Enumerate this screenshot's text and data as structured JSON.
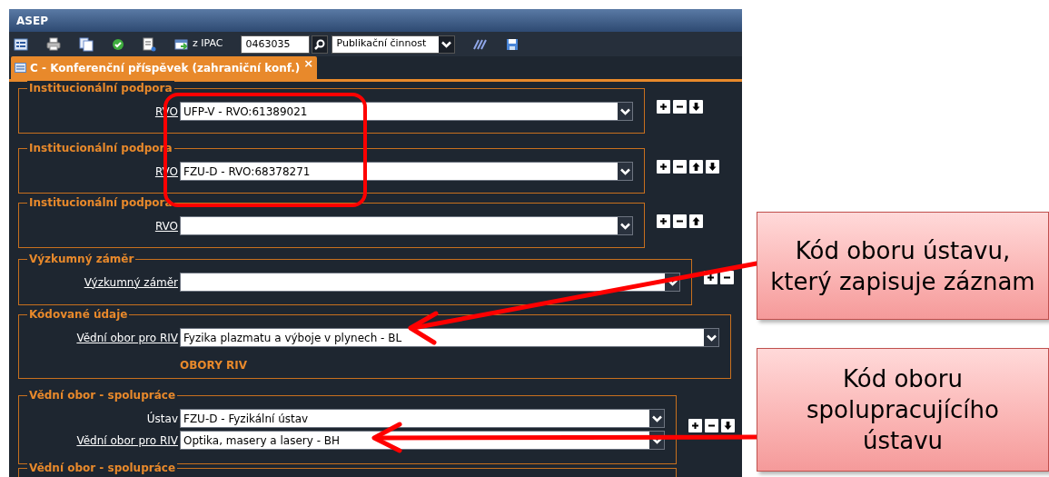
{
  "window": {
    "title": "ASEP"
  },
  "toolbar": {
    "import_button": {
      "label": "z IPAC"
    },
    "record_field": {
      "value": "0463035"
    },
    "type_select": {
      "value": "Publikační činnost"
    }
  },
  "tabs": [
    {
      "label": "C - Konferenční příspěvek (zahraniční konf.)",
      "selected": true,
      "close": "×"
    }
  ],
  "sections": [
    {
      "legend": "Institucionální podpora",
      "fields": [
        {
          "label": "RVO",
          "link": true,
          "value": "UFP-V - RVO:61389021"
        }
      ],
      "actions": [
        {
          "kind": "add"
        },
        {
          "kind": "remove"
        },
        {
          "kind": "down"
        }
      ]
    },
    {
      "legend": "Institucionální podpora",
      "fields": [
        {
          "label": "RVO",
          "link": true,
          "value": "FZU-D - RVO:68378271"
        }
      ],
      "actions": [
        {
          "kind": "add"
        },
        {
          "kind": "remove"
        },
        {
          "kind": "up"
        },
        {
          "kind": "down"
        }
      ]
    },
    {
      "legend": "Institucionální podpora",
      "fields": [
        {
          "label": "RVO",
          "link": true
        }
      ],
      "actions": [
        {
          "kind": "add"
        },
        {
          "kind": "remove"
        },
        {
          "kind": "up"
        }
      ]
    },
    {
      "legend": "Výzkumný záměr",
      "fields": [
        {
          "label": "Výzkumný záměr",
          "link": true
        }
      ],
      "actions": [
        {
          "kind": "add"
        },
        {
          "kind": "remove"
        }
      ]
    },
    {
      "legend": "Kódované údaje",
      "fields": [
        {
          "label": "Vědní obor pro RIV",
          "link": true,
          "value": "Fyzika plazmatu a výboje v plynech - BL"
        }
      ],
      "note": "OBORY RIV"
    },
    {
      "legend": "Vědní obor - spolupráce",
      "fields": [
        {
          "label": "Ústav",
          "link": false,
          "value": "FZU-D - Fyzikální ústav"
        },
        {
          "label": "Vědní obor pro RIV",
          "link": true,
          "value": "Optika, masery a lasery - BH"
        }
      ],
      "actions": [
        {
          "kind": "add"
        },
        {
          "kind": "remove"
        },
        {
          "kind": "down"
        }
      ]
    },
    {
      "legend": "Vědní obor - spolupráce"
    }
  ],
  "callouts": [
    {
      "text": "Kód oboru ústavu, který zapisuje záznam"
    },
    {
      "text": "Kód oboru spolupracujícího ústavu"
    }
  ]
}
